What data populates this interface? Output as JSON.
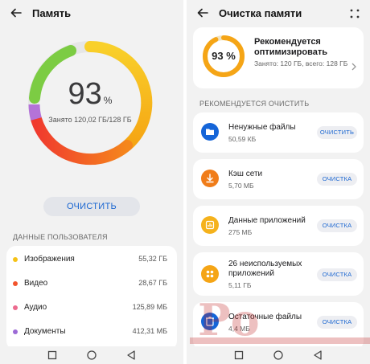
{
  "left": {
    "title": "Память",
    "ring": {
      "percent": 93,
      "percent_sign": "%",
      "subtitle": "Занято 120,02 ГБ/128 ГБ"
    },
    "clean_button": "ОЧИСТИТЬ",
    "section_label": "ДАННЫЕ ПОЛЬЗОВАТЕЛЯ",
    "items": [
      {
        "name": "Изображения",
        "value": "55,32 ГБ",
        "color": "#f5c216"
      },
      {
        "name": "Видео",
        "value": "28,67 ГБ",
        "color": "#f2542d"
      },
      {
        "name": "Аудио",
        "value": "125,89 МБ",
        "color": "#ec6b8f"
      },
      {
        "name": "Документы",
        "value": "412,31 МБ",
        "color": "#9c6ad6"
      }
    ]
  },
  "right": {
    "title": "Очистка памяти",
    "summary": {
      "percent": "93 %",
      "title": "Рекомендуется оптимизировать",
      "subtitle": "Занято: 120 ГБ, всего: 128 ГБ"
    },
    "section_label": "РЕКОМЕНДУЕТСЯ ОЧИСТИТЬ",
    "items": [
      {
        "name": "Ненужные файлы",
        "size": "50,59 КБ",
        "button": "ОЧИСТИТЬ",
        "color": "#1565d8",
        "icon": "folder-icon"
      },
      {
        "name": "Кэш сети",
        "size": "5,70 МБ",
        "button": "ОЧИСТКА",
        "color": "#f07d1a",
        "icon": "download-icon"
      },
      {
        "name": "Данные приложений",
        "size": "275 МБ",
        "button": "ОЧИСТКА",
        "color": "#f5b21c",
        "icon": "chart-icon"
      },
      {
        "name": "26 неиспользуемых приложений",
        "size": "5,11 ГБ",
        "button": "ОЧИСТКА",
        "color": "#f5a516",
        "icon": "apps-grid-icon"
      },
      {
        "name": "Остаточные файлы",
        "size": "4,4 МБ",
        "button": "ОЧИСТКА",
        "color": "#1565d8",
        "icon": "residual-files-icon"
      }
    ]
  },
  "colors": {
    "accent": "#1a66d1",
    "ring_yellow": "#f7c21a",
    "ring_orange": "#f36a1e",
    "ring_red": "#f0412e",
    "ring_green": "#7ccc43",
    "ring_purple": "#9c6ad6"
  },
  "watermark": "Ро"
}
